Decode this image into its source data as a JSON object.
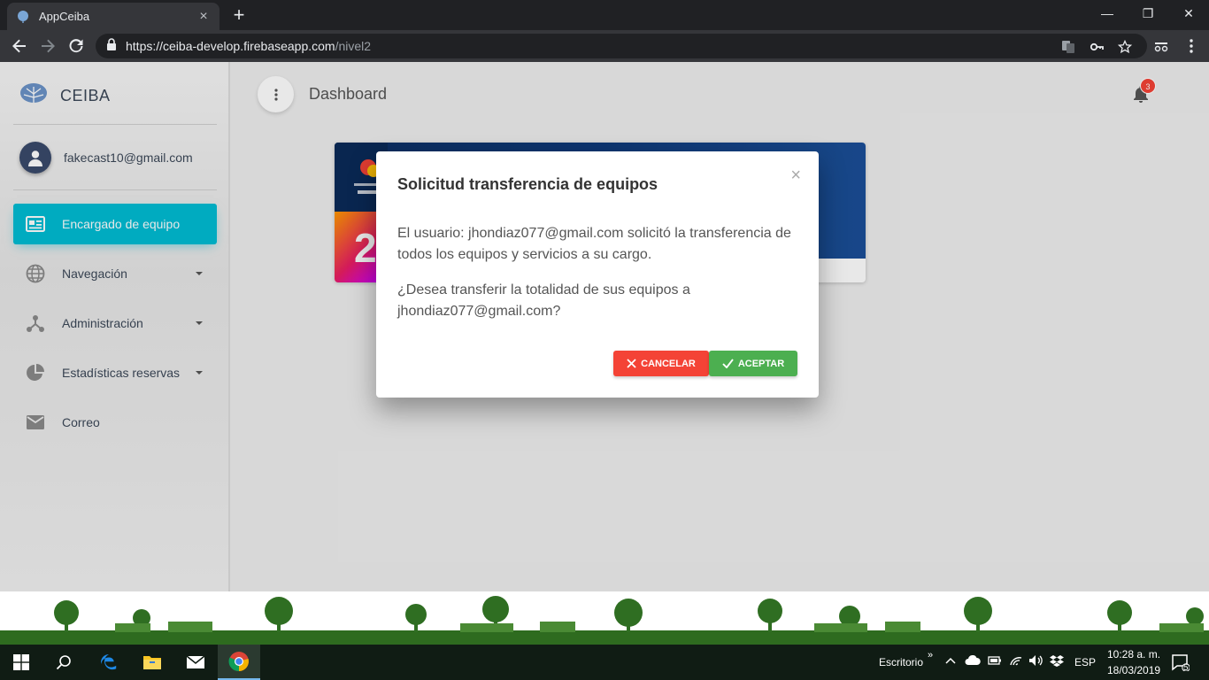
{
  "browser": {
    "tab_title": "AppCeiba",
    "tab_close": "×",
    "new_tab": "+",
    "url_host": "https://ceiba-develop.firebaseapp.com",
    "url_path": "/nivel2",
    "window_controls": {
      "minimize": "—",
      "restore": "❐",
      "close": "✕"
    }
  },
  "sidebar": {
    "brand": "CEIBA",
    "user_email": "fakecast10@gmail.com",
    "items": [
      {
        "label": "Encargado de equipo",
        "icon": "contact-card-icon",
        "active": true,
        "has_caret": false
      },
      {
        "label": "Navegación",
        "icon": "globe-icon",
        "active": false,
        "has_caret": true
      },
      {
        "label": "Administración",
        "icon": "network-icon",
        "active": false,
        "has_caret": true
      },
      {
        "label": "Estadísticas reservas",
        "icon": "pie-chart-icon",
        "active": false,
        "has_caret": true
      },
      {
        "label": "Correo",
        "icon": "mail-icon",
        "active": false,
        "has_caret": false
      }
    ]
  },
  "header": {
    "title": "Dashboard",
    "notification_count": "3"
  },
  "modal": {
    "title": "Solicitud transferencia de equipos",
    "close": "×",
    "message1": "El usuario: jhondiaz077@gmail.com solicitó la transferencia de todos los equipos y servicios a su cargo.",
    "message2": "¿Desea transferir la totalidad de sus equipos a jhondiaz077@gmail.com?",
    "cancel_label": "CANCELAR",
    "accept_label": "ACEPTAR"
  },
  "taskbar": {
    "desktop_label": "Escritorio",
    "language": "ESP",
    "time": "10:28 a. m.",
    "date": "18/03/2019",
    "notifications": "5"
  },
  "colors": {
    "accent": "#00bcd4",
    "cancel": "#f44336",
    "accept": "#4caf50",
    "badge": "#f44336"
  }
}
